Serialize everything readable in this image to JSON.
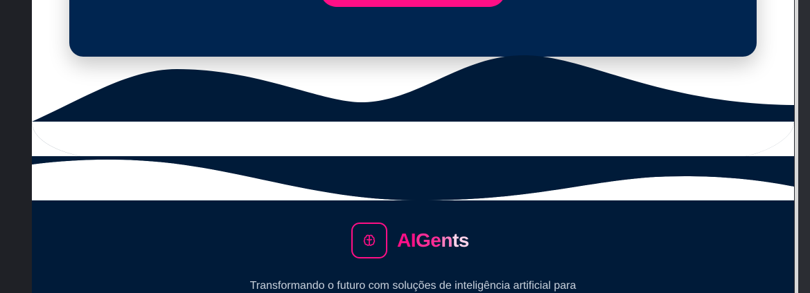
{
  "brand": {
    "part_ai": "AI",
    "part_ge": "Ge",
    "part_n": "n",
    "part_ts": "ts",
    "logo_icon": "brain-icon"
  },
  "footer": {
    "tagline": "Transformando o futuro com soluções de inteligência artificial para"
  },
  "cta": {
    "button_label": ""
  },
  "colors": {
    "navy": "#002550",
    "footer_navy": "#001b39",
    "accent": "#ff0f86"
  }
}
